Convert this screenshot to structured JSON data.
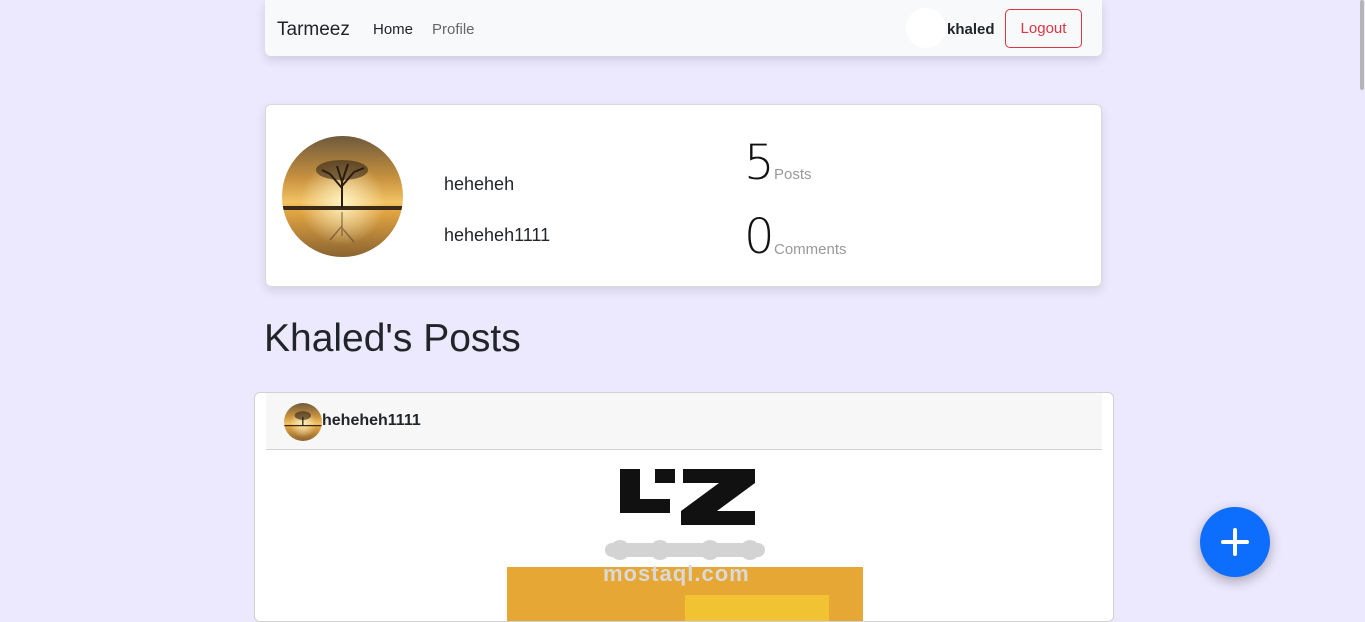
{
  "navbar": {
    "brand": "Tarmeez",
    "links": [
      {
        "label": "Home"
      },
      {
        "label": "Profile"
      }
    ],
    "username": "khaled",
    "logout_label": "Logout"
  },
  "profile": {
    "name": "heheheh",
    "username": "heheheh1111",
    "posts_count": "5",
    "posts_label": "Posts",
    "comments_count": "0",
    "comments_label": "Comments",
    "avatar_icon": "sunset-tree-photo"
  },
  "posts_section": {
    "title": "Khaled's Posts"
  },
  "post": {
    "author": "heheheh1111",
    "avatar_icon": "sunset-tree-photo",
    "image": {
      "logo_latin_text": "mostaql.com",
      "watermark_icon": "mostaql-logo"
    }
  },
  "fab": {
    "icon": "plus-icon",
    "color": "#0d6efd"
  },
  "colors": {
    "background": "#ece8fd",
    "danger": "#dc3545",
    "primary": "#0d6efd"
  }
}
